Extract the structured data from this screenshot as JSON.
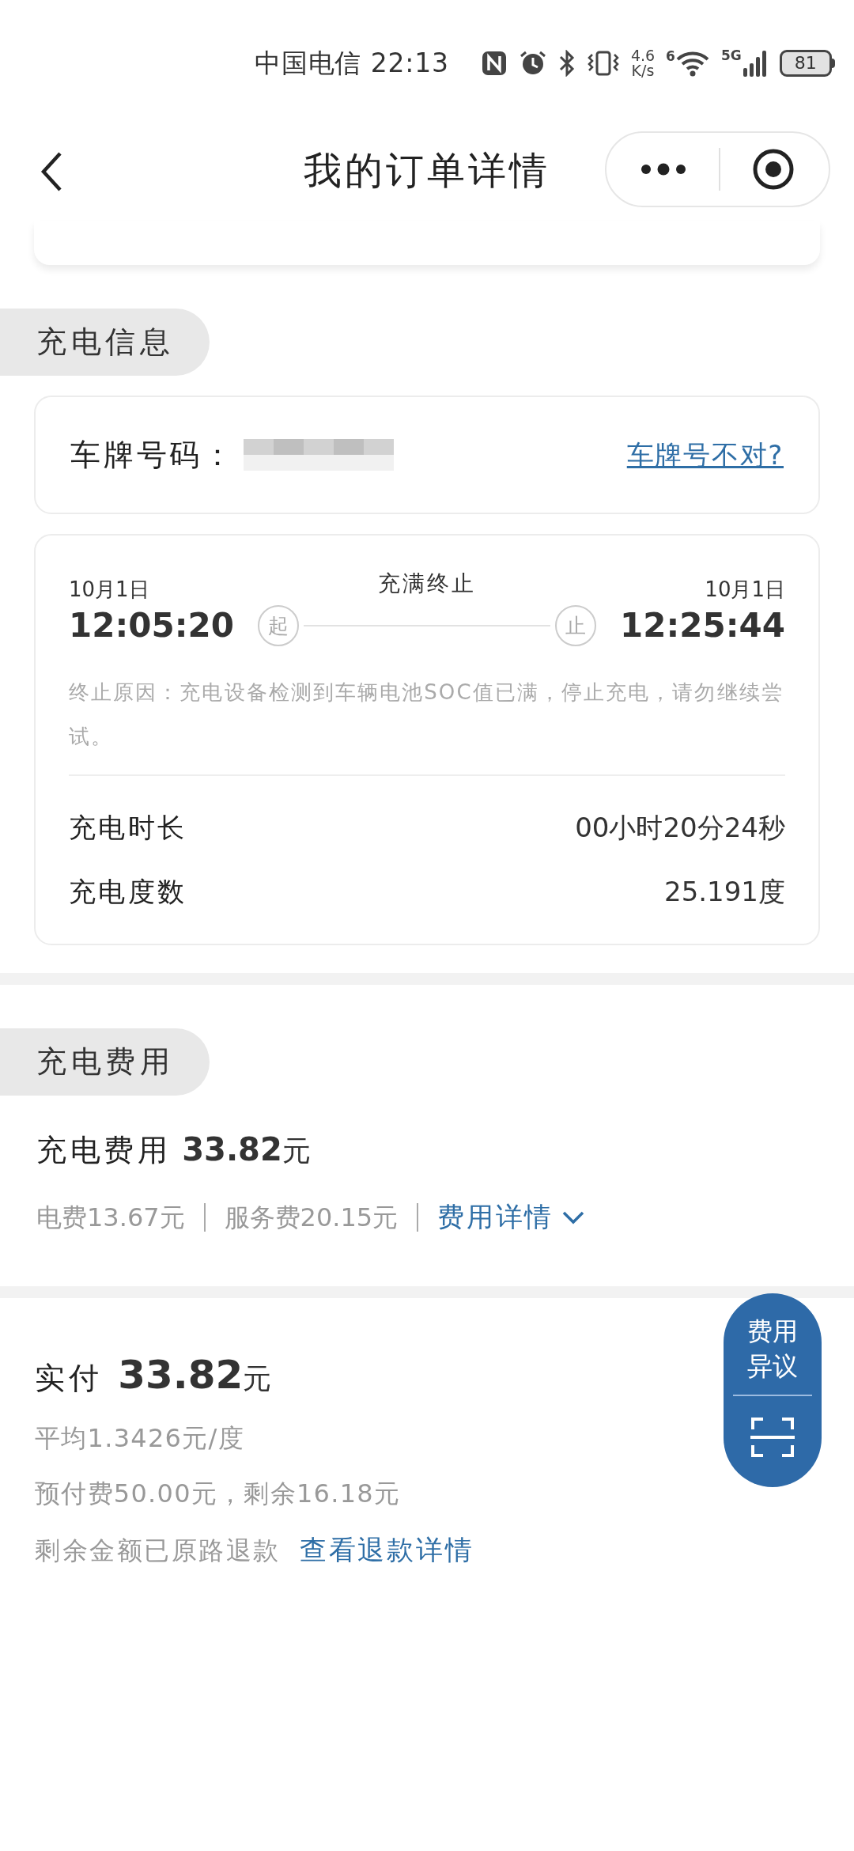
{
  "status_bar": {
    "carrier": "中国电信",
    "time": "22:13",
    "net_speed_value": "4.6",
    "net_speed_unit": "K/s",
    "wifi_label": "6",
    "cell_label": "5G",
    "battery": "81"
  },
  "header": {
    "back": true,
    "title": "我的订单详情"
  },
  "charging_info": {
    "section_title": "充电信息",
    "plate": {
      "label": "车牌号码：",
      "redacted": true,
      "link": "车牌号不对?"
    },
    "session": {
      "start_date": "10月1日",
      "start_time": "12:05:20",
      "start_badge": "起",
      "status": "充满终止",
      "end_badge": "止",
      "end_date": "10月1日",
      "end_time": "12:25:44",
      "reason": "终止原因：充电设备检测到车辆电池SOC值已满，停止充电，请勿继续尝试。",
      "stats": [
        {
          "label": "充电时长",
          "value": "00小时20分24秒"
        },
        {
          "label": "充电度数",
          "value": "25.191度"
        }
      ]
    }
  },
  "charging_fee": {
    "section_title": "充电费用",
    "total_label": "充电费用",
    "total_amount": "33.82",
    "total_unit": "元",
    "breakdown": [
      "电费13.67元",
      "服务费20.15元"
    ],
    "details_link": "费用详情"
  },
  "payment": {
    "label": "实付",
    "amount": "33.82",
    "unit": "元",
    "lines": [
      "平均1.3426元/度",
      "预付费50.00元，剩余16.18元"
    ],
    "refund_text": "剩余金额已原路退款",
    "refund_link": "查看退款详情"
  },
  "dispute_button": {
    "label": "费用异议"
  }
}
